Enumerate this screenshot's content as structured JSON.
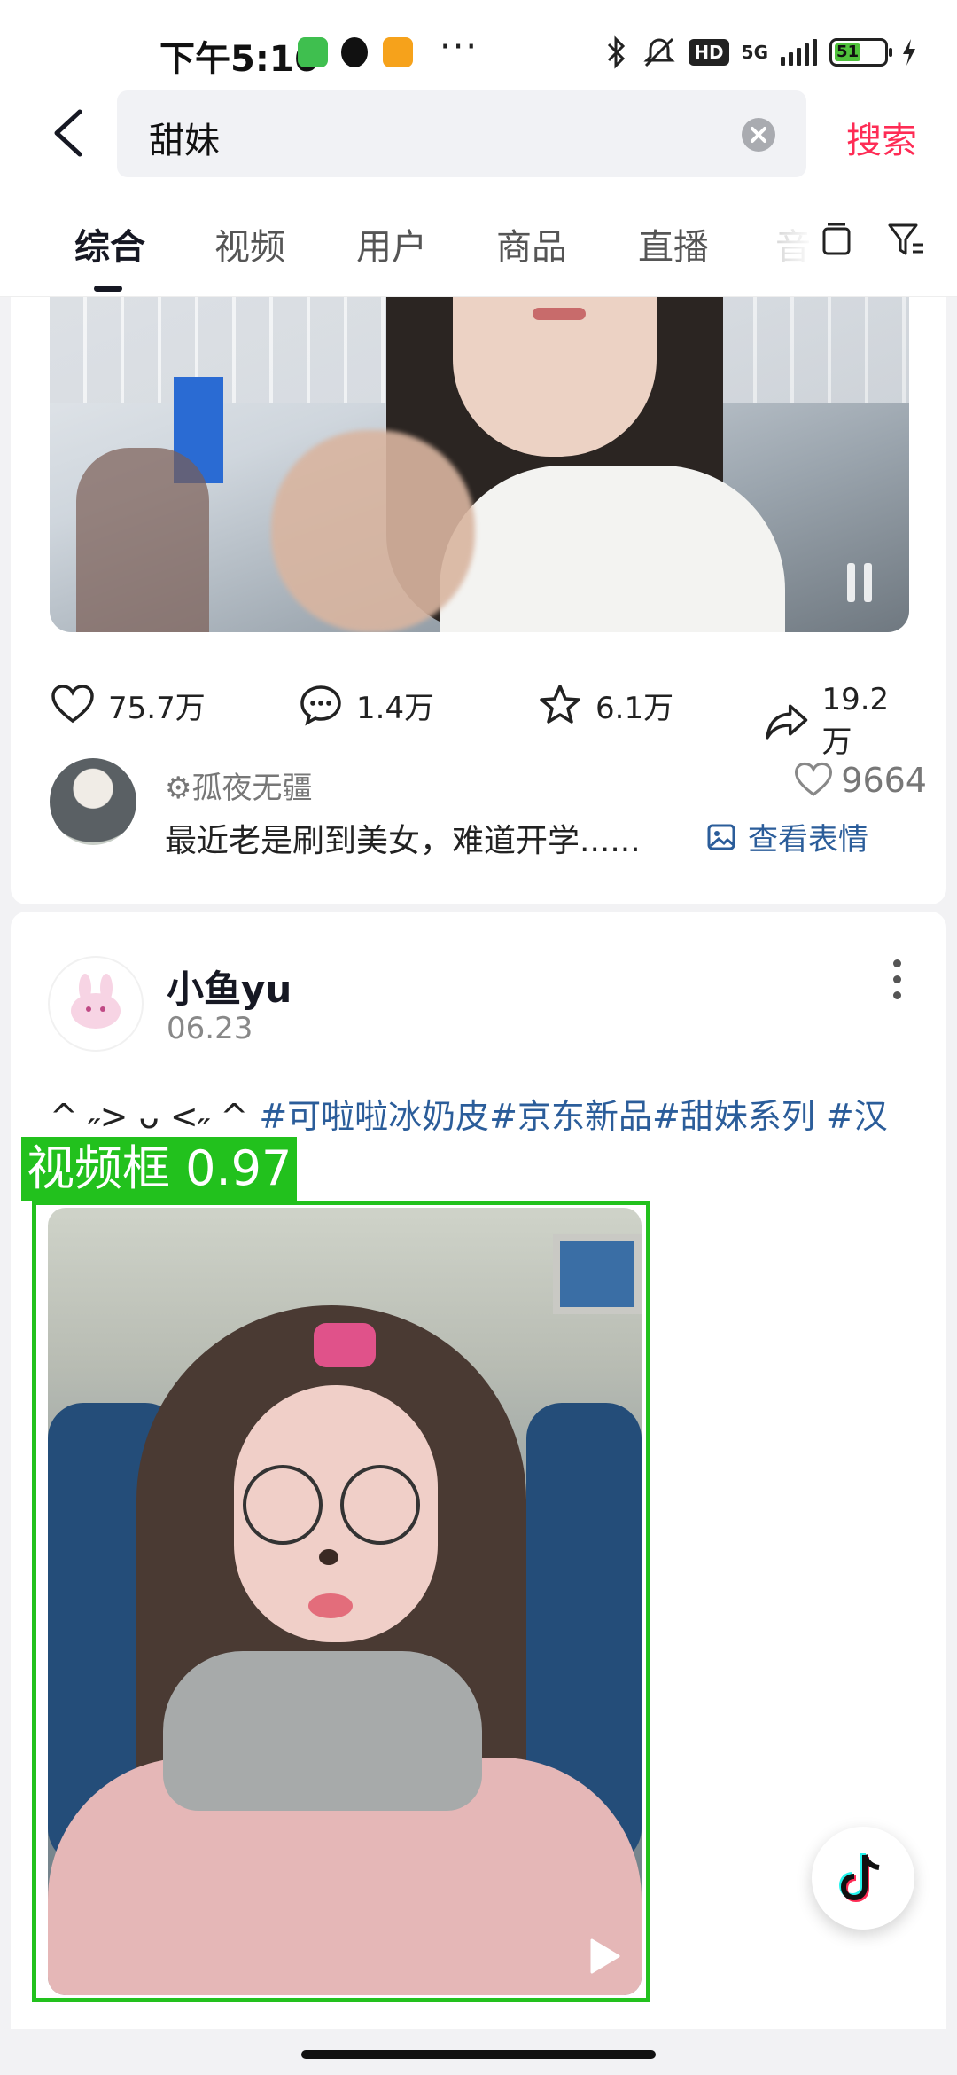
{
  "status_bar": {
    "time": "下午5:16",
    "network": "5G",
    "hd_label": "HD",
    "battery": "51",
    "icons": [
      "wechat-like-app-icon",
      "qq-icon",
      "58-app-icon",
      "bluetooth-icon",
      "mute-icon",
      "charging-icon"
    ]
  },
  "search": {
    "query": "甜妹",
    "submit_label": "搜索"
  },
  "tabs": {
    "items": [
      "综合",
      "视频",
      "用户",
      "商品",
      "直播",
      "音"
    ],
    "active": "综合"
  },
  "post1": {
    "stats": {
      "likes": "75.7万",
      "comments": "1.4万",
      "favorites": "6.1万",
      "shares": "19.2万"
    },
    "top_comment": {
      "author": "孤夜无疆",
      "text": "最近老是刷到美女，难道开学......",
      "likes": "9664",
      "emoji_link": "查看表情"
    }
  },
  "post2": {
    "author": "小鱼yu",
    "date": "06.23",
    "desc_prefix": "^ ˶> ᴗ <˶ ^ ",
    "desc_tags": "#可啦啦冰奶皮#京东新品#甜妹系列 #汉"
  },
  "detection": {
    "label": "视频框 0.97",
    "color": "#22c11d"
  },
  "colors": {
    "accent": "#fe2c55",
    "link": "#2b5d9a"
  }
}
